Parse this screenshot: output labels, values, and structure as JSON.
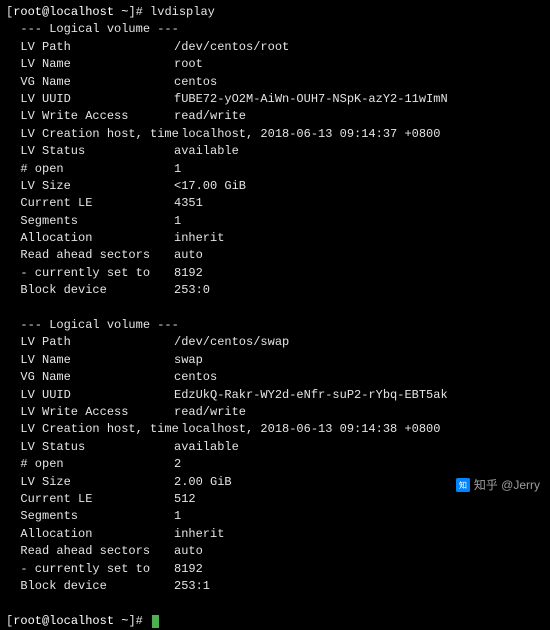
{
  "prompt": {
    "open": "[",
    "user_host": "root@localhost",
    "cwd": " ~",
    "close": "]# ",
    "command": "lvdisplay"
  },
  "section_header": "  --- Logical volume ---",
  "volumes": [
    {
      "rows": [
        {
          "label": "  LV Path",
          "value": "/dev/centos/root"
        },
        {
          "label": "  LV Name",
          "value": "root"
        },
        {
          "label": "  VG Name",
          "value": "centos"
        },
        {
          "label": "  LV UUID",
          "value": "fUBE72-yO2M-AiWn-OUH7-NSpK-azY2-11wImN"
        },
        {
          "label": "  LV Write Access",
          "value": "read/write"
        },
        {
          "label": "  LV Creation host, time",
          "value": " localhost, 2018-06-13 09:14:37 +0800"
        },
        {
          "label": "  LV Status",
          "value": "available"
        },
        {
          "label": "  # open",
          "value": "1"
        },
        {
          "label": "  LV Size",
          "value": "<17.00 GiB"
        },
        {
          "label": "  Current LE",
          "value": "4351"
        },
        {
          "label": "  Segments",
          "value": "1"
        },
        {
          "label": "  Allocation",
          "value": "inherit"
        },
        {
          "label": "  Read ahead sectors",
          "value": "auto"
        },
        {
          "label": "  - currently set to",
          "value": "8192"
        },
        {
          "label": "  Block device",
          "value": "253:0"
        }
      ]
    },
    {
      "rows": [
        {
          "label": "  LV Path",
          "value": "/dev/centos/swap"
        },
        {
          "label": "  LV Name",
          "value": "swap"
        },
        {
          "label": "  VG Name",
          "value": "centos"
        },
        {
          "label": "  LV UUID",
          "value": "EdzUkQ-Rakr-WY2d-eNfr-suP2-rYbq-EBT5ak"
        },
        {
          "label": "  LV Write Access",
          "value": "read/write"
        },
        {
          "label": "  LV Creation host, time",
          "value": " localhost, 2018-06-13 09:14:38 +0800"
        },
        {
          "label": "  LV Status",
          "value": "available"
        },
        {
          "label": "  # open",
          "value": "2"
        },
        {
          "label": "  LV Size",
          "value": "2.00 GiB"
        },
        {
          "label": "  Current LE",
          "value": "512"
        },
        {
          "label": "  Segments",
          "value": "1"
        },
        {
          "label": "  Allocation",
          "value": "inherit"
        },
        {
          "label": "  Read ahead sectors",
          "value": "auto"
        },
        {
          "label": "  - currently set to",
          "value": "8192"
        },
        {
          "label": "  Block device",
          "value": "253:1"
        }
      ]
    }
  ],
  "watermark": "知乎 @Jerry"
}
